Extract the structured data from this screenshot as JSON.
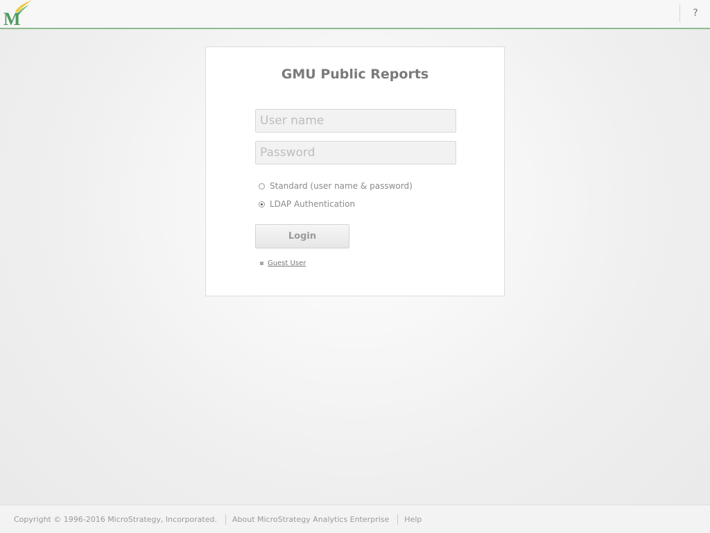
{
  "header": {
    "logo_icon": "mason-m-logo-icon",
    "help_label": "?",
    "accent_color": "#8fb98f"
  },
  "login": {
    "title": "GMU Public Reports",
    "username_placeholder": "User name",
    "username_value": "",
    "password_placeholder": "Password",
    "password_value": "",
    "auth_options": [
      {
        "label": "Standard (user name & password)",
        "selected": false
      },
      {
        "label": "LDAP Authentication",
        "selected": true
      }
    ],
    "login_button_label": "Login",
    "guest_link_label": "Guest User"
  },
  "footer": {
    "copyright": "Copyright © 1996-2016 MicroStrategy, Incorporated.",
    "about_link": "About MicroStrategy Analytics Enterprise",
    "help_link": "Help"
  }
}
